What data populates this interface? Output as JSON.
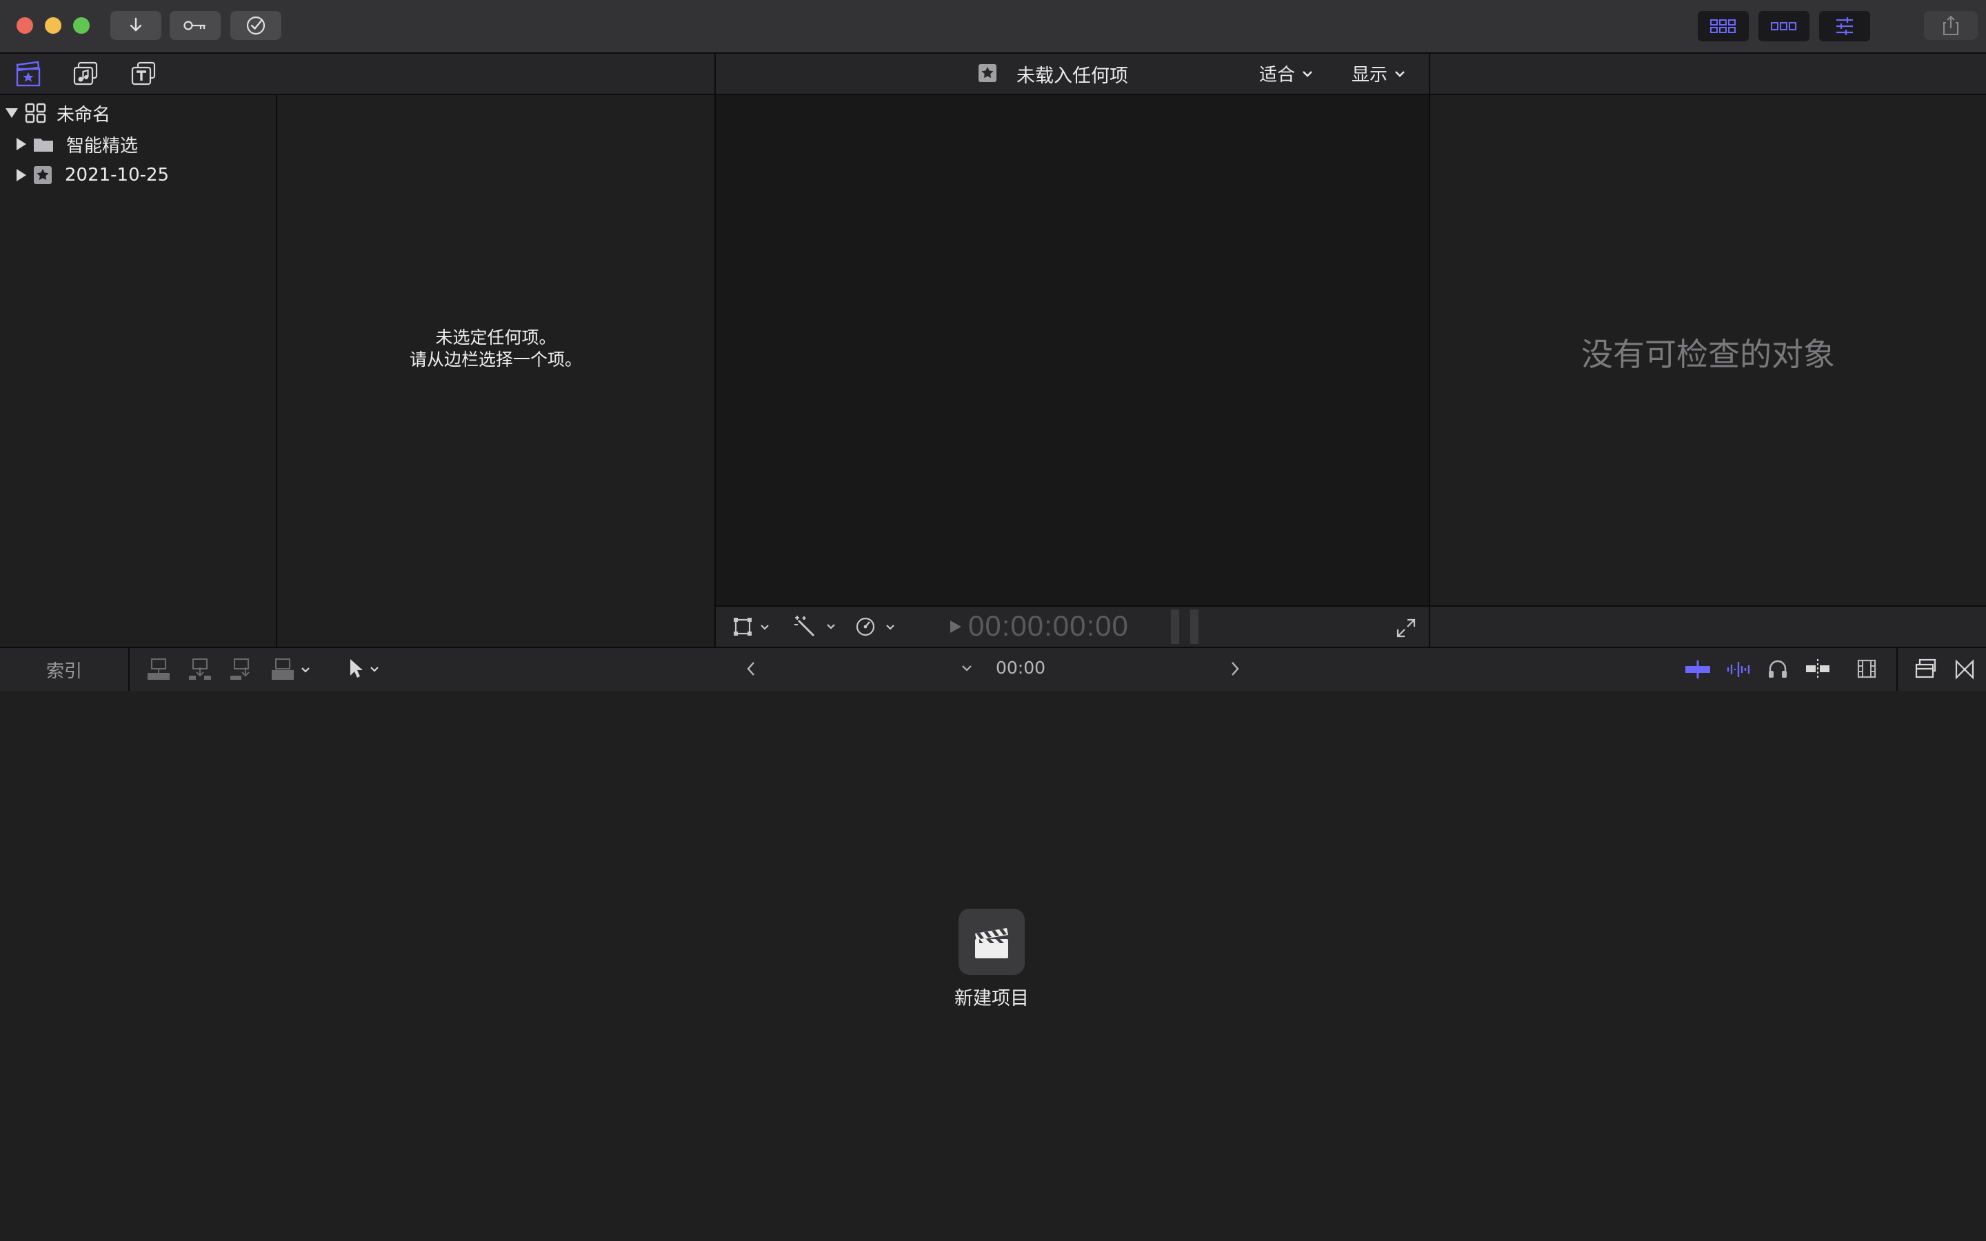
{
  "sidebar": {
    "library_name": "未命名",
    "items": [
      {
        "label": "智能精选",
        "icon": "folder-icon"
      },
      {
        "label": "2021-10-25",
        "icon": "event-star-icon"
      }
    ]
  },
  "browser": {
    "message_line1": "未选定任何项。",
    "message_line2": "请从边栏选择一个项。"
  },
  "viewer": {
    "title": "未载入任何项",
    "fit_label": "适合",
    "display_label": "显示",
    "timecode": "00:00:00:00"
  },
  "inspector": {
    "empty_message": "没有可检查的对象"
  },
  "timeline": {
    "index_label": "索引",
    "timecode": "00:00",
    "new_project_label": "新建项目"
  },
  "colors": {
    "accent": "#6b67ff",
    "titlebar": "#333335",
    "panel": "#1f1f1f",
    "close": "#ed6a5e",
    "minimize": "#f4bf4f",
    "zoom": "#61c554"
  }
}
